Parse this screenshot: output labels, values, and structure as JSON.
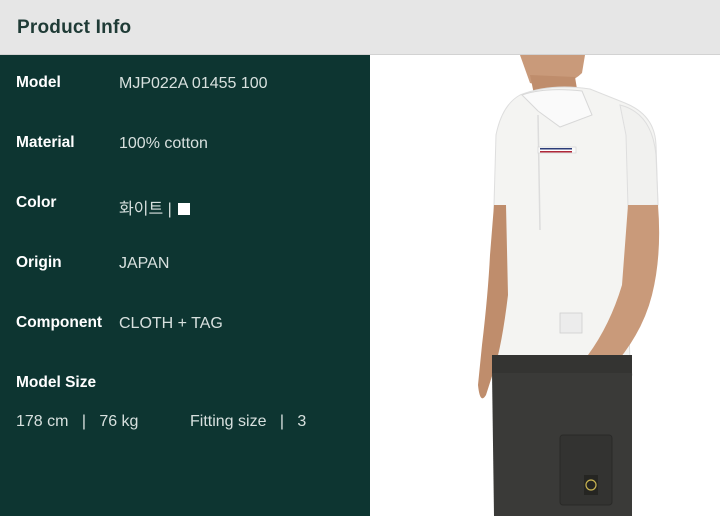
{
  "header": {
    "title": "Product Info"
  },
  "specs": [
    {
      "label": "Model",
      "value": "MJP022A 01455 100"
    },
    {
      "label": "Material",
      "value": "100% cotton"
    },
    {
      "label": "Color",
      "value": "화이트 |"
    },
    {
      "label": "Origin",
      "value": "JAPAN"
    },
    {
      "label": "Component",
      "value": "CLOTH + TAG"
    }
  ],
  "model_size": {
    "label": "Model Size",
    "height": "178 cm",
    "separator": "|",
    "weight": "76 kg",
    "fitting_label": "Fitting size",
    "fitting_value": "3"
  },
  "colors": {
    "header_bg": "#e6e6e6",
    "panel_bg": "#0d3531",
    "header_text": "#1f3b36",
    "shirt": "#f4f4f2",
    "pants": "#3a3a38"
  },
  "photo": {
    "subject": "model wearing white polo shirt with tricolor pocket stripe and dark cargo pants"
  }
}
